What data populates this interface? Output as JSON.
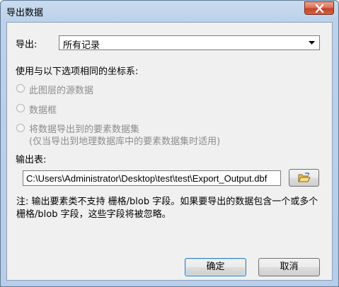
{
  "window": {
    "title": "导出数据"
  },
  "export": {
    "label": "导出:",
    "selected": "所有记录"
  },
  "coord": {
    "heading": "使用与以下选项相同的坐标系:",
    "options": [
      {
        "label": "此图层的源数据"
      },
      {
        "label": "数据框"
      },
      {
        "label": "将数据导出到的要素数据集",
        "sublabel": "(仅当导出到地理数据库中的要素数据集时适用)"
      }
    ]
  },
  "output": {
    "label": "输出表:",
    "value": "C:\\Users\\Administrator\\Desktop\\test\\test\\Export_Output.dbf"
  },
  "note": "注: 输出要素类不支持 栅格/blob 字段。如果要导出的数据包含一个或多个 栅格/blob 字段，这些字段将被忽略。",
  "buttons": {
    "ok": "确定",
    "cancel": "取消"
  },
  "icons": {
    "close": "close-icon",
    "dropdown": "chevron-down-icon",
    "browse": "folder-open-icon"
  }
}
